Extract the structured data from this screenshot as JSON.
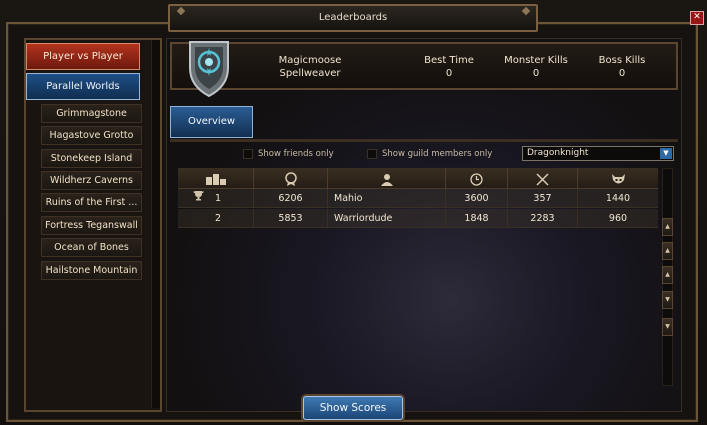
{
  "window": {
    "title": "Leaderboards",
    "close_label": "✕"
  },
  "sidebar": {
    "categories": [
      {
        "label": "Player vs Player"
      },
      {
        "label": "Parallel Worlds"
      }
    ],
    "zones": [
      {
        "label": "Grimmagstone"
      },
      {
        "label": "Hagastove Grotto"
      },
      {
        "label": "Stonekeep Island"
      },
      {
        "label": "Wildherz Caverns"
      },
      {
        "label": "Ruins of the First ..."
      },
      {
        "label": "Fortress Teganswall"
      },
      {
        "label": "Ocean of Bones"
      },
      {
        "label": "Hailstone Mountain"
      }
    ]
  },
  "header": {
    "guild_name": "Magicmoose",
    "player_name": "Spellweaver",
    "stats": [
      {
        "label": "Best Time",
        "value": "0"
      },
      {
        "label": "Monster Kills",
        "value": "0"
      },
      {
        "label": "Boss Kills",
        "value": "0"
      }
    ]
  },
  "tabs": {
    "overview": "Overview"
  },
  "filters": {
    "friends_label": "Show friends only",
    "guild_label": "Show guild members only",
    "class_selected": "Dragonknight"
  },
  "table": {
    "columns": [
      "rank-icon",
      "score-icon",
      "player-icon",
      "time-icon",
      "monster-kills-icon",
      "boss-kills-icon"
    ],
    "rows": [
      {
        "rank": "1",
        "score": "6206",
        "name": "Mahio",
        "time": "3600",
        "monsters": "357",
        "bosses": "1440"
      },
      {
        "rank": "2",
        "score": "5853",
        "name": "Warriordude",
        "time": "1848",
        "monsters": "2283",
        "bosses": "960"
      }
    ]
  },
  "footer": {
    "show_scores_label": "Show Scores"
  },
  "colors": {
    "accent_red": "#b3331d",
    "accent_blue": "#2a5d94",
    "frame_bronze": "#7a6040"
  }
}
